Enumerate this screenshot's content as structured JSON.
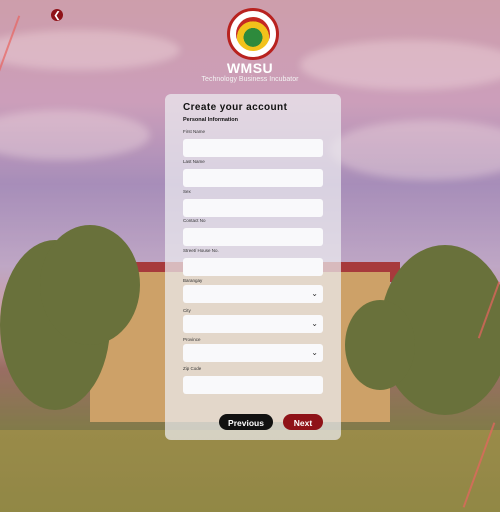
{
  "brand": {
    "name": "WMSU",
    "subtitle": "Technology Business Incubator"
  },
  "form": {
    "title": "Create your account",
    "section": "Personal Information",
    "fields": [
      {
        "label": "First Name",
        "type": "text",
        "value": ""
      },
      {
        "label": "Last Name",
        "type": "text",
        "value": ""
      },
      {
        "label": "Sex",
        "type": "text",
        "value": ""
      },
      {
        "label": "Contact No",
        "type": "text",
        "value": ""
      },
      {
        "label": "Street/ House No.",
        "type": "text",
        "value": ""
      },
      {
        "label": "Barangay",
        "type": "select",
        "value": ""
      },
      {
        "label": "City",
        "type": "select",
        "value": ""
      },
      {
        "label": "Province",
        "type": "select",
        "value": ""
      },
      {
        "label": "Zip Code",
        "type": "text",
        "value": ""
      }
    ],
    "buttons": {
      "previous": "Previous",
      "next": "Next"
    }
  },
  "icons": {
    "back": "chevron-left-icon",
    "dropdown": "chevron-down-icon",
    "logo": "wmsu-tbi-logo"
  },
  "colors": {
    "accent": "#8f1218",
    "dark_button": "#111111"
  }
}
